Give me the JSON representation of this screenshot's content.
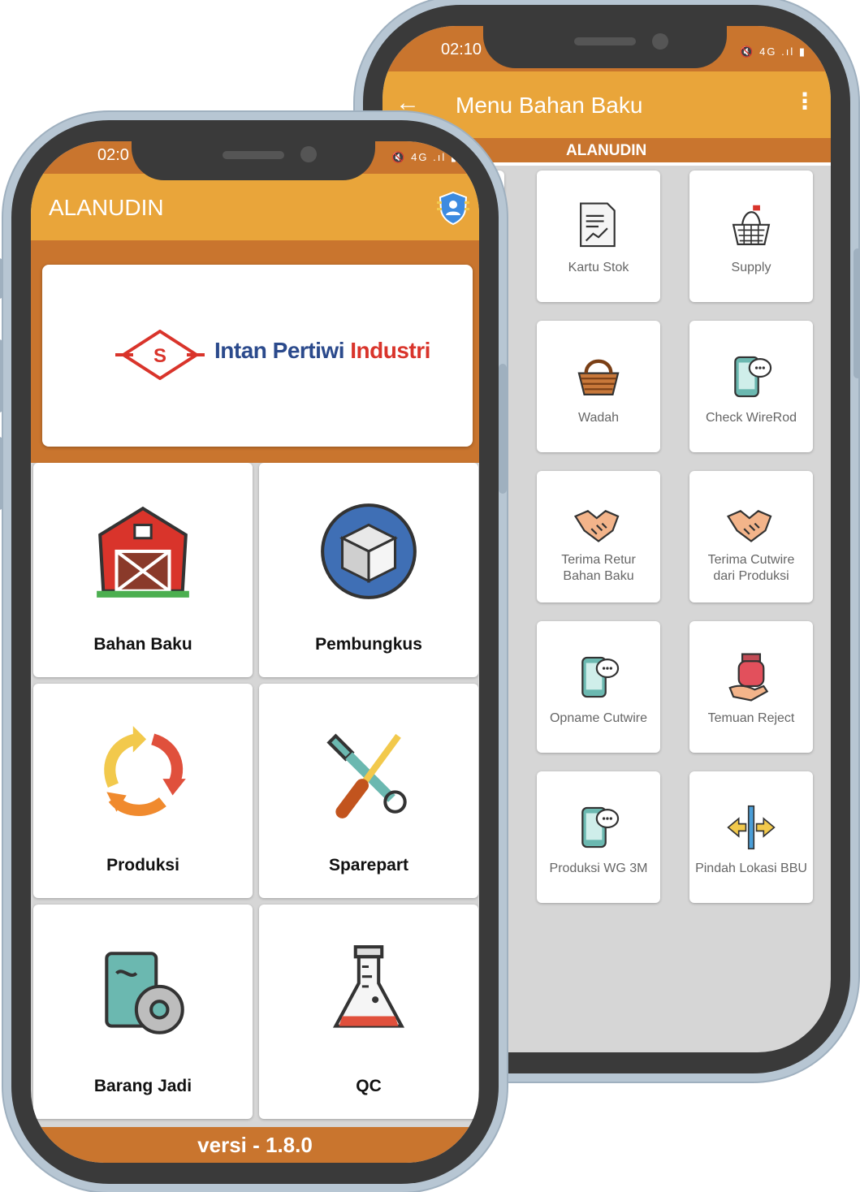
{
  "back_phone": {
    "status_time": "02:10",
    "status_icons": "🔇 4G .ıl ▮",
    "appbar_title": "Menu Bahan Baku",
    "back_icon": "arrow-left-icon",
    "menu_icon": "more-vert-icon",
    "user_strip": "ALANUDIN",
    "menu_items": [
      {
        "label": "Kartu Stok",
        "icon": "stock-card-icon"
      },
      {
        "label": "Supply",
        "icon": "basket-icon"
      },
      {
        "label": "Wadah",
        "icon": "wicker-basket-icon"
      },
      {
        "label": "Check WireRod",
        "icon": "phone-chat-icon"
      },
      {
        "label": "Terima Retur\nBahan Baku",
        "icon": "handshake-icon"
      },
      {
        "label": "Terima Cutwire\ndari Produksi",
        "icon": "handshake-icon"
      },
      {
        "label": "Opname Cutwire",
        "icon": "phone-chat-icon"
      },
      {
        "label": "Temuan Reject",
        "icon": "jar-hand-icon"
      },
      {
        "label": "Produksi WG 3M",
        "icon": "phone-chat-icon"
      },
      {
        "label": "Pindah Lokasi BBU",
        "icon": "move-arrows-icon"
      }
    ]
  },
  "front_phone": {
    "status_time": "02:0",
    "status_icons": "🔇 4G .ıl ▮",
    "appbar_title": "ALANUDIN",
    "badge_icon": "user-shield-icon",
    "brand": {
      "logo_letter": "S",
      "part1": "Intan Pertiwi",
      "part2": "Industri"
    },
    "menu_items": [
      {
        "label": "Bahan Baku",
        "icon": "barn-icon"
      },
      {
        "label": "Pembungkus",
        "icon": "box-icon"
      },
      {
        "label": "Produksi",
        "icon": "recycle-arrows-icon"
      },
      {
        "label": "Sparepart",
        "icon": "tools-icon"
      },
      {
        "label": "Barang Jadi",
        "icon": "book-disc-icon"
      },
      {
        "label": "QC",
        "icon": "flask-icon"
      }
    ],
    "footer": "versi - 1.8.0"
  },
  "colors": {
    "orange_dark": "#c9752e",
    "orange_light": "#e9a53a",
    "brand_red": "#d9342b",
    "brand_blue": "#2b4a8c"
  }
}
